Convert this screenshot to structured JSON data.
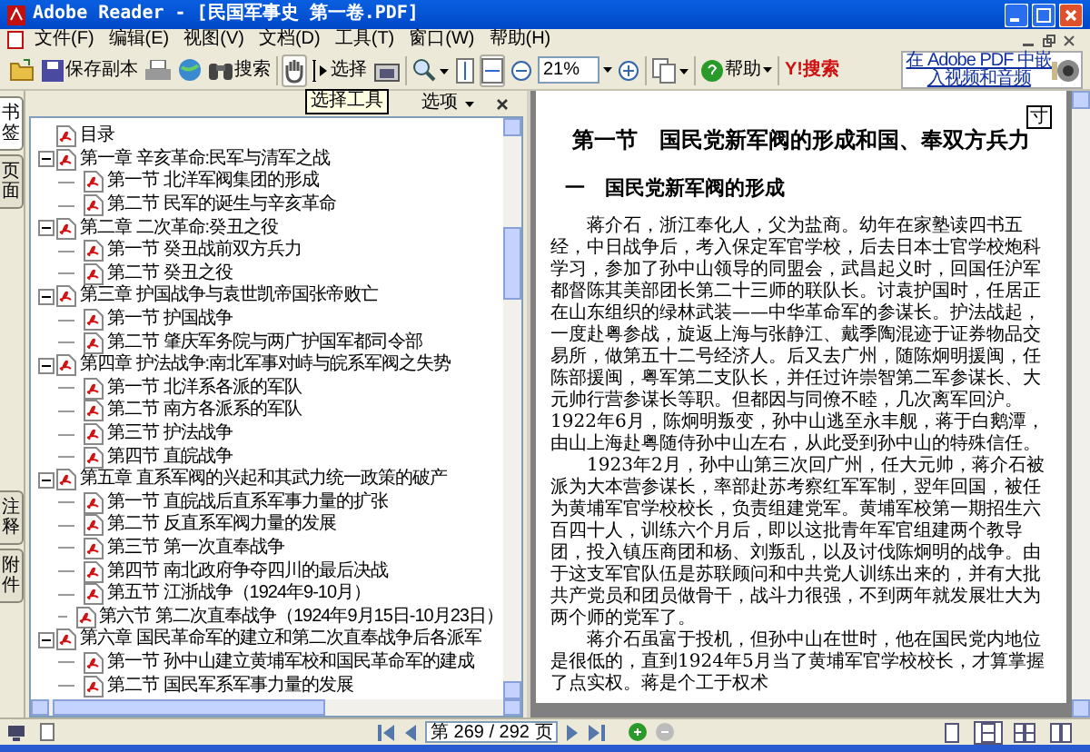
{
  "window": {
    "title": "Adobe Reader - [民国军事史 第一卷.PDF]"
  },
  "menu": [
    "文件(F)",
    "编辑(E)",
    "视图(V)",
    "文档(D)",
    "工具(T)",
    "窗口(W)",
    "帮助(H)"
  ],
  "toolbar": [
    {
      "kind": "open"
    },
    {
      "kind": "save",
      "label": "保存副本"
    },
    {
      "kind": "print"
    },
    {
      "kind": "email"
    },
    {
      "kind": "search",
      "label": "搜索"
    },
    {
      "kind": "hand",
      "selected": true
    },
    {
      "kind": "select",
      "label": "选择",
      "selected": false
    },
    {
      "kind": "snapshot"
    },
    {
      "kind": "zoom"
    },
    {
      "kind": "fitpage",
      "selected": false
    },
    {
      "kind": "fitwidth",
      "selected": true
    },
    {
      "kind": "zoomout"
    },
    {
      "kind": "zoomfield",
      "value": "21%"
    },
    {
      "kind": "zoomin"
    },
    {
      "kind": "pages"
    },
    {
      "kind": "help",
      "label": "帮助"
    },
    {
      "kind": "yahoo",
      "label": "Y!搜索"
    }
  ],
  "ad": {
    "line_1": "在 Adobe PDF 中嵌",
    "line_2": "入视频和音频"
  },
  "tooltip": "选择工具",
  "side_tabs_top": [
    {
      "label": "书签",
      "selected": true
    },
    {
      "label": "页面",
      "selected": false
    }
  ],
  "side_tabs_bottom": [
    {
      "label": "注释",
      "selected": false
    },
    {
      "label": "附件",
      "selected": false
    }
  ],
  "panel": {
    "options": "选项"
  },
  "bookmarks": [
    {
      "label": "目录"
    },
    {
      "label": "第一章 辛亥革命:民军与清军之战",
      "expanded": true,
      "children": [
        {
          "label": "第一节 北洋军阀集团的形成"
        },
        {
          "label": "第二节 民军的诞生与辛亥革命"
        }
      ]
    },
    {
      "label": "第二章 二次革命:癸丑之役",
      "expanded": true,
      "children": [
        {
          "label": "第一节 癸丑战前双方兵力"
        },
        {
          "label": "第二节 癸丑之役"
        }
      ]
    },
    {
      "label": "第三章 护国战争与袁世凯帝国张帝败亡",
      "expanded": true,
      "children": [
        {
          "label": "第一节 护国战争"
        },
        {
          "label": "第二节 肇庆军务院与两广护国军都司令部"
        }
      ]
    },
    {
      "label": "第四章 护法战争:南北军事对峙与皖系军阀之失势",
      "expanded": true,
      "children": [
        {
          "label": "第一节 北洋系各派的军队"
        },
        {
          "label": "第二节 南方各派系的军队"
        },
        {
          "label": "第三节 护法战争"
        },
        {
          "label": "第四节 直皖战争"
        }
      ]
    },
    {
      "label": "第五章 直系军阀的兴起和其武力统一政策的破产",
      "expanded": true,
      "children": [
        {
          "label": "第一节 直皖战后直系军事力量的扩张"
        },
        {
          "label": "第二节 反直系军阀力量的发展"
        },
        {
          "label": "第三节 第一次直奉战争"
        },
        {
          "label": "第四节 南北政府争夺四川的最后决战"
        },
        {
          "label": "第五节 江浙战争（1924年9-10月）"
        },
        {
          "label": "第六节 第二次直奉战争（1924年9月15日-10月23日）"
        }
      ]
    },
    {
      "label": "第六章 国民革命军的建立和第二次直奉战争后各派军",
      "expanded": true,
      "children": [
        {
          "label": "第一节 孙中山建立黄埔军校和国民革命军的建成"
        },
        {
          "label": "第二节 国民军系军事力量的发展"
        }
      ]
    }
  ],
  "document": {
    "page_mark": "寸",
    "heading": "第一节　国民党新军阀的形成和国、奉双方兵力",
    "subheading": "一　国民党新军阀的形成",
    "paragraphs": [
      "蒋介石，浙江奉化人，父为盐商。幼年在家塾读四书五经，中日战争后，考入保定军官学校，后去日本士官学校炮科学习，参加了孙中山领导的同盟会，武昌起义时，回国任沪军都督陈其美部团长第二十三师的联队长。讨袁护国时，任居正在山东组织的绿林武装——中华革命军的参谋长。护法战起，一度赴粤参战，旋返上海与张静江、戴季陶混迹于证券物品交易所，做第五十二号经济人。后又去广州，随陈炯明援闽，任陈部援闽，粤军第二支队长，并任过许崇智第二军参谋长、大元帅行营参谋长等职。但都因与同僚不睦，几次离军回沪。1922年6月，陈炯明叛变，孙中山逃至永丰舰，蒋于白鹅潭，由山上海赴粤随侍孙中山左右，从此受到孙中山的特殊信任。",
      "1923年2月，孙中山第三次回广州，任大元帅，蒋介石被派为大本营参谋长，率部赴苏考察红军军制，翌年回国，被任为黄埔军官学校校长，负责组建党军。黄埔军校第一期招生六百四十人，训练六个月后，即以这批青年军官组建两个教导团，投入镇压商团和杨、刘叛乱，以及讨伐陈炯明的战争。由于这支军官队伍是苏联顾问和中共党人训练出来的，并有大批共产党员和团员做骨干，战斗力很强，不到两年就发展壮大为两个师的党军了。",
      "蒋介石虽富于投机，但孙中山在世时，他在国民党内地位是很低的，直到1924年5月当了黄埔军官学校校长，才算掌握了点实权。蒋是个工于权术"
    ]
  },
  "status_bar": {
    "page_field": "第 269 / 292 页",
    "views": [
      {
        "kind": "single",
        "selected": false
      },
      {
        "kind": "continuous",
        "selected": true
      },
      {
        "kind": "continuous-facing",
        "selected": false
      },
      {
        "kind": "facing",
        "selected": false
      }
    ]
  }
}
